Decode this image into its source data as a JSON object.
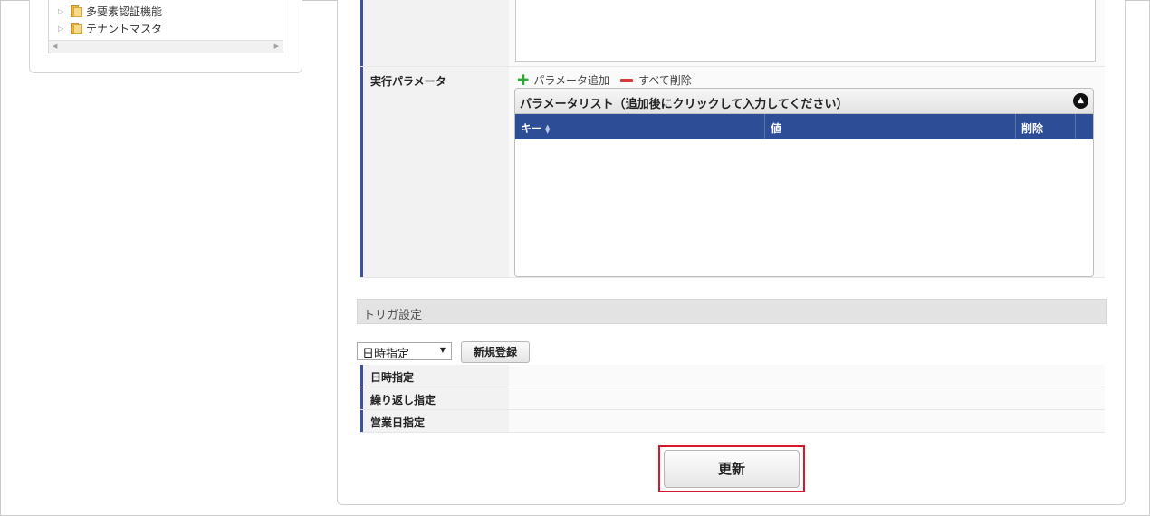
{
  "tree": {
    "items": [
      {
        "label": "多要素認証機能"
      },
      {
        "label": "テナントマスタ"
      }
    ]
  },
  "form": {
    "exec_params": {
      "label": "実行パラメータ",
      "add_label": "パラメータ追加",
      "delete_all_label": "すべて削除",
      "grid": {
        "caption": "パラメータリスト（追加後にクリックして入力してください）",
        "columns": [
          "キー",
          "値",
          "削除"
        ],
        "rows": []
      }
    }
  },
  "trigger": {
    "section_title": "トリガ設定",
    "select_value": "日時指定",
    "new_button": "新規登録",
    "rows": [
      {
        "label": "日時指定"
      },
      {
        "label": "繰り返し指定"
      },
      {
        "label": "営業日指定"
      }
    ]
  },
  "update_button": "更新",
  "colors": {
    "accent": "#2d4e96",
    "label_bar": "#3a539b",
    "highlight": "#d7172b",
    "add_icon": "#35a53a",
    "delete_icon": "#d63b3b"
  }
}
